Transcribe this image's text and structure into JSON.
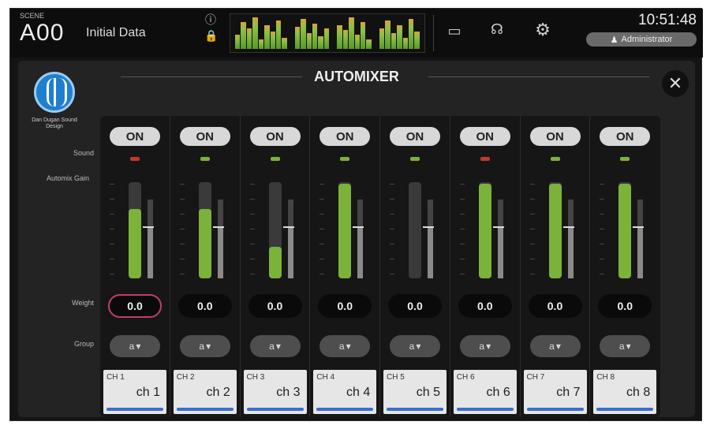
{
  "header": {
    "scene_label": "SCENE",
    "scene_number": "A00",
    "scene_name": "Initial Data",
    "clock": "10:51:48",
    "user": "Administrator",
    "icons": [
      "info-icon",
      "lock-icon",
      "display-icon",
      "headphones-icon",
      "gear-icon"
    ]
  },
  "panel": {
    "title": "AUTOMIXER",
    "logo_text": "Dan Dugan Sound Design",
    "labels": {
      "sound": "Sound",
      "gain": "Automix Gain",
      "weight": "Weight",
      "group": "Group"
    }
  },
  "channels": [
    {
      "on_label": "ON",
      "weight": "0.0",
      "group": "a",
      "num": "CH 1",
      "name": "ch 1",
      "led_color": "#c0392b",
      "gain_level": 0.72,
      "sub_level": 0.66,
      "selected": true
    },
    {
      "on_label": "ON",
      "weight": "0.0",
      "group": "a",
      "num": "CH 2",
      "name": "ch 2",
      "led_color": "#7bb23a",
      "gain_level": 0.72,
      "sub_level": 0.66,
      "selected": false
    },
    {
      "on_label": "ON",
      "weight": "0.0",
      "group": "a",
      "num": "CH 3",
      "name": "ch 3",
      "led_color": "#7bb23a",
      "gain_level": 0.33,
      "sub_level": 0.66,
      "selected": false
    },
    {
      "on_label": "ON",
      "weight": "0.0",
      "group": "a",
      "num": "CH 4",
      "name": "ch 4",
      "led_color": "#7bb23a",
      "gain_level": 0.98,
      "sub_level": 0.66,
      "selected": false
    },
    {
      "on_label": "ON",
      "weight": "0.0",
      "group": "a",
      "num": "CH 5",
      "name": "ch 5",
      "led_color": "#7bb23a",
      "gain_level": 0.0,
      "sub_level": 0.66,
      "selected": false
    },
    {
      "on_label": "ON",
      "weight": "0.0",
      "group": "a",
      "num": "CH 6",
      "name": "ch 6",
      "led_color": "#c0392b",
      "gain_level": 0.98,
      "sub_level": 0.66,
      "selected": false
    },
    {
      "on_label": "ON",
      "weight": "0.0",
      "group": "a",
      "num": "CH 7",
      "name": "ch 7",
      "led_color": "#7bb23a",
      "gain_level": 0.98,
      "sub_level": 0.66,
      "selected": false
    },
    {
      "on_label": "ON",
      "weight": "0.0",
      "group": "a",
      "num": "CH 8",
      "name": "ch 8",
      "led_color": "#7bb23a",
      "gain_level": 0.98,
      "sub_level": 0.66,
      "selected": false
    }
  ]
}
